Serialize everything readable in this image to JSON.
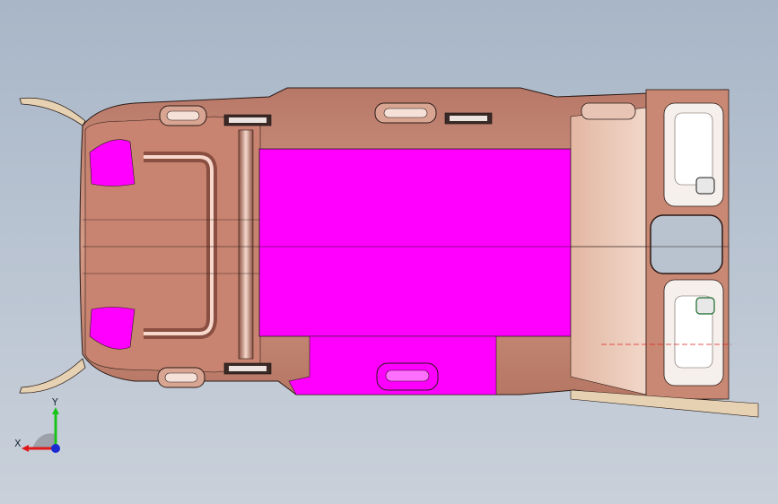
{
  "viewport": {
    "background_top": "#a8b6c7",
    "background_bottom": "#c9d0da"
  },
  "model": {
    "body_color": "#c98873",
    "body_shade": "#a86552",
    "highlight_color": "#ff00ff",
    "edge_color": "#2a1a16",
    "beige_trim": "#e6d2b2"
  },
  "triad": {
    "x_label": "X",
    "y_label": "Y",
    "x_color": "#e01818",
    "y_color": "#18c418",
    "z_color": "#1a2ad0"
  }
}
